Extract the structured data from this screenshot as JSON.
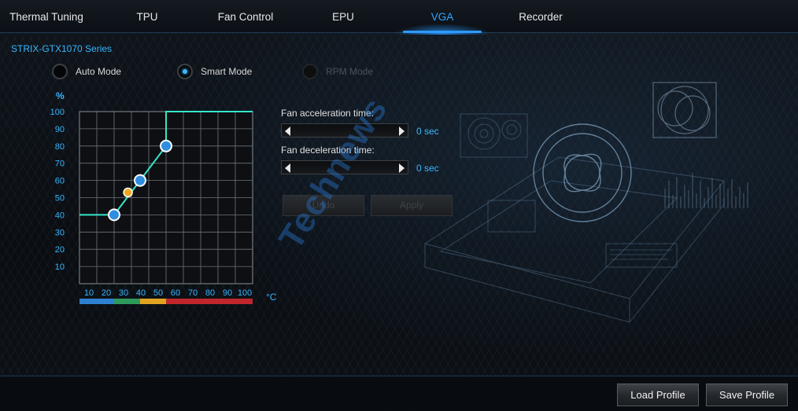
{
  "tabs": [
    {
      "label": "Thermal Tuning",
      "active": false
    },
    {
      "label": "TPU",
      "active": false
    },
    {
      "label": "Fan Control",
      "active": false
    },
    {
      "label": "EPU",
      "active": false
    },
    {
      "label": "VGA",
      "active": true
    },
    {
      "label": "Recorder",
      "active": false
    }
  ],
  "series_title": "STRIX-GTX1070 Series",
  "modes": [
    {
      "label": "Auto Mode",
      "selected": false,
      "enabled": true
    },
    {
      "label": "Smart Mode",
      "selected": true,
      "enabled": true
    },
    {
      "label": "RPM Mode",
      "selected": false,
      "enabled": false
    }
  ],
  "fan_curve": {
    "y_unit": "%",
    "x_unit": "°C",
    "y_ticks": [
      "100",
      "90",
      "80",
      "70",
      "60",
      "50",
      "40",
      "30",
      "20",
      "10"
    ],
    "x_ticks": [
      "10",
      "20",
      "30",
      "40",
      "50",
      "60",
      "70",
      "80",
      "90",
      "100"
    ],
    "curve_points": [
      [
        0,
        40
      ],
      [
        20,
        40
      ],
      [
        35,
        60
      ],
      [
        50,
        80
      ],
      [
        50,
        100
      ],
      [
        100,
        100
      ]
    ],
    "handles": [
      {
        "x": 20,
        "y": 40,
        "color": "#2f8de0"
      },
      {
        "x": 35,
        "y": 60,
        "color": "#2f8de0"
      },
      {
        "x": 50,
        "y": 80,
        "color": "#2f8de0"
      }
    ],
    "marker": {
      "x": 28,
      "y": 53,
      "color": "#f0a81e"
    },
    "temp_bands": [
      {
        "from": 0,
        "to": 20,
        "color": "#2f7fd0"
      },
      {
        "from": 20,
        "to": 35,
        "color": "#2d9a5c"
      },
      {
        "from": 35,
        "to": 50,
        "color": "#e0a321"
      },
      {
        "from": 50,
        "to": 100,
        "color": "#c0272d"
      }
    ],
    "line_color": "#35e6c9"
  },
  "fan_acceleration": {
    "label": "Fan acceleration time:",
    "value": "0 sec"
  },
  "fan_deceleration": {
    "label": "Fan deceleration time:",
    "value": "0 sec"
  },
  "buttons": {
    "undo": "Undo",
    "apply": "Apply",
    "load_profile": "Load Profile",
    "save_profile": "Save Profile"
  },
  "watermark": {
    "text": "Technews",
    "color": "#2878d2"
  },
  "colors": {
    "accent": "#2ea6ff"
  }
}
